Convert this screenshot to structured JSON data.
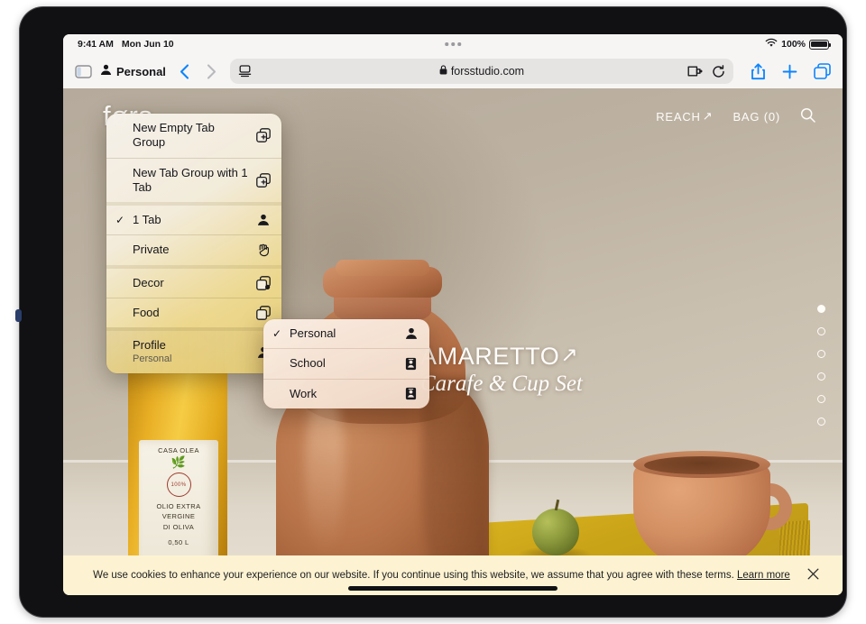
{
  "status_bar": {
    "time": "9:41 AM",
    "date": "Mon Jun 10",
    "battery_percent": "100%",
    "wifi_icon": "wifi-icon",
    "battery_icon": "battery-full-icon",
    "multitask_icon": "multitasking-dots-icon"
  },
  "toolbar": {
    "sidebar_icon": "sidebar-icon",
    "profile_icon": "person-icon",
    "profile_label": "Personal",
    "back_icon": "chevron-left-icon",
    "forward_icon": "chevron-right-icon",
    "reader_icon": "page-reader-icon",
    "lock_icon": "lock-icon",
    "url": "forsstudio.com",
    "extensions_icon": "extensions-puzzle-icon",
    "reload_icon": "reload-icon",
    "share_icon": "share-icon",
    "new_tab_icon": "plus-icon",
    "tabs_icon": "tab-overview-icon"
  },
  "tab_group_menu": {
    "items": [
      {
        "label": "New Empty Tab Group",
        "sub": "",
        "checked": false,
        "icon": "square-stack-plus-icon"
      },
      {
        "label": "New Tab Group with 1 Tab",
        "sub": "",
        "checked": false,
        "icon": "square-stack-plus-icon"
      },
      {
        "label": "1 Tab",
        "sub": "",
        "checked": true,
        "icon": "person-icon"
      },
      {
        "label": "Private",
        "sub": "",
        "checked": false,
        "icon": "hand-raised-icon"
      },
      {
        "label": "Decor",
        "sub": "",
        "checked": false,
        "icon": "square-stack-badge-icon"
      },
      {
        "label": "Food",
        "sub": "",
        "checked": false,
        "icon": "square-stack-icon"
      },
      {
        "label": "Profile",
        "sub": "Personal",
        "checked": false,
        "icon": "person-icon"
      }
    ],
    "checkmark": "✓"
  },
  "profile_submenu": {
    "items": [
      {
        "label": "Personal",
        "checked": true,
        "icon": "person-icon"
      },
      {
        "label": "School",
        "checked": false,
        "icon": "id-card-icon"
      },
      {
        "label": "Work",
        "checked": false,
        "icon": "id-card-icon"
      }
    ],
    "checkmark": "✓"
  },
  "website": {
    "logo": "førs",
    "nav": [
      {
        "label": "REACH",
        "arrow": "↗",
        "name": "reach"
      },
      {
        "label": "BAG (0)",
        "arrow": "",
        "name": "bag"
      }
    ],
    "search_icon": "search-icon",
    "product_title": "AMARETTO",
    "product_title_arrow": "↗",
    "product_subtitle": "Carafe & Cup Set",
    "slide_count": 6,
    "active_slide": 1,
    "bottle_label": {
      "brand": "CASA OLEA",
      "line1": "OLIO EXTRA",
      "line2": "VERGINE",
      "line3": "DI OLIVA",
      "volume": "0,50 L",
      "seal": "100%"
    }
  },
  "cookie_banner": {
    "text": "We use cookies to enhance your experience on our website. If you continue using this website, we assume that you agree with these terms.",
    "learn_more": "Learn more",
    "close_icon": "close-icon"
  },
  "colors": {
    "accent_blue": "#0a84ff",
    "menu_warm": "#efda8f",
    "cookie_bg": "#fdf3d2"
  }
}
